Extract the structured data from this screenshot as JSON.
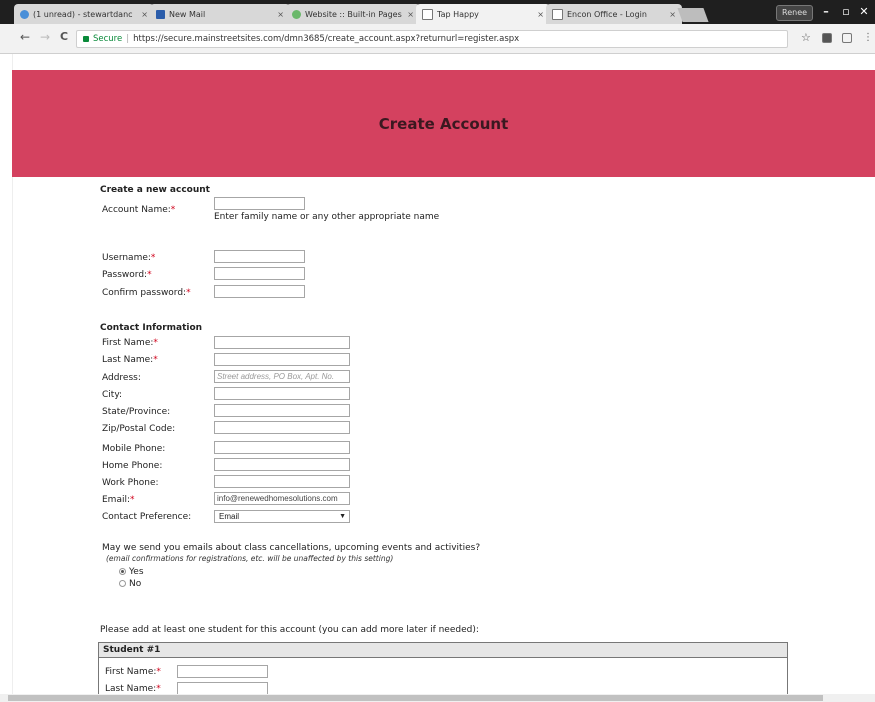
{
  "browser": {
    "tabs": [
      {
        "title": "(1 unread) - stewartdanc",
        "active": false
      },
      {
        "title": "New Mail",
        "active": false
      },
      {
        "title": "Website :: Built-in Pages",
        "active": false
      },
      {
        "title": "Tap Happy",
        "active": true
      },
      {
        "title": "Encon Office - Login",
        "active": false
      }
    ],
    "tab_close": "×",
    "user_label": "Renee",
    "secure_label": "Secure",
    "url": "https://secure.mainstreetsites.com/dmn3685/create_account.aspx?returnurl=register.aspx",
    "back_glyph": "←",
    "forward_glyph": "→",
    "reload_glyph": "C",
    "star_glyph": "☆",
    "min_glyph": "–",
    "max_glyph": "▫",
    "close_glyph": "✕",
    "menu_glyph": "⋮"
  },
  "page": {
    "title": "Create Account",
    "section_account": "Create a new account",
    "account_name_label": "Account Name:",
    "account_name_hint": "Enter family name or any other appropriate name",
    "username_label": "Username:",
    "password_label": "Password:",
    "confirm_password_label": "Confirm password:",
    "required_mark": "*",
    "section_contact": "Contact Information",
    "first_name_label": "First Name:",
    "last_name_label": "Last Name:",
    "address_label": "Address:",
    "address_placeholder": "Street address, PO Box, Apt. No.",
    "city_label": "City:",
    "state_label": "State/Province:",
    "zip_label": "Zip/Postal Code:",
    "mobile_label": "Mobile Phone:",
    "home_label": "Home Phone:",
    "work_label": "Work Phone:",
    "email_label": "Email:",
    "email_value": "info@renewedhomesolutions.com",
    "contact_pref_label": "Contact Preference:",
    "contact_pref_value": "Email",
    "emails_question": "May we send you emails about class cancellations, upcoming events and activities?",
    "emails_note": "(email confirmations for registrations, etc. will be unaffected by this setting)",
    "yes_label": "Yes",
    "no_label": "No",
    "student_prompt": "Please add at least one student for this account (you can add more later if needed):",
    "student_header": "Student #1",
    "student_first_label": "First Name:",
    "student_last_label": "Last Name:"
  },
  "colors": {
    "banner": "#d4415f",
    "required": "#d0021b",
    "secure": "#0a8a3a"
  }
}
